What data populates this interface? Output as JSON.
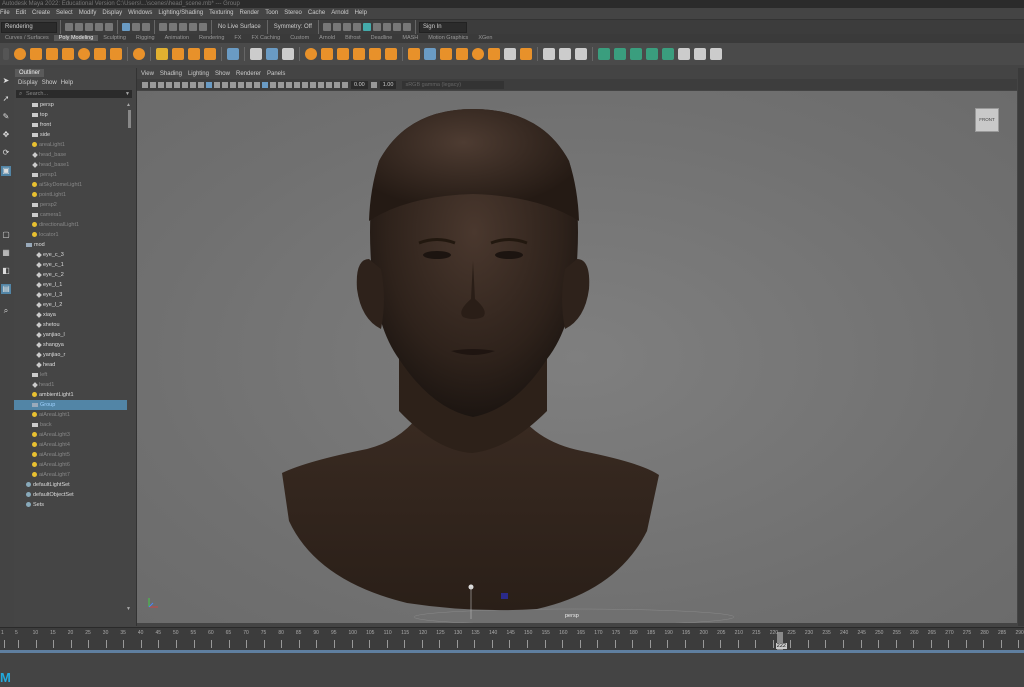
{
  "title_bar": "Autodesk Maya 2022: Educational Version C:\\Users\\...\\scenes\\head_scene.mb* --- Group",
  "menubar": [
    "File",
    "Edit",
    "Create",
    "Select",
    "Modify",
    "Display",
    "Windows",
    "Lighting/Shading",
    "Texturing",
    "Render",
    "Toon",
    "Stereo",
    "Cache",
    "Arnold",
    "Help"
  ],
  "status_line": {
    "menuset": "Rendering",
    "live_surface": "No Live Surface",
    "symmetry": "Symmetry: Off",
    "sign_in": "Sign In"
  },
  "shelf_tabs": [
    "Curves / Surfaces",
    "Poly Modeling",
    "Sculpting",
    "Rigging",
    "Animation",
    "Rendering",
    "FX",
    "FX Caching",
    "Custom",
    "Arnold",
    "Bifrost",
    "Deadline",
    "MASH",
    "Motion Graphics",
    "XGen"
  ],
  "shelf_active_tab": "Poly Modeling",
  "outliner": {
    "title": "Outliner",
    "menu": [
      "Display",
      "Show",
      "Help"
    ],
    "search_placeholder": "Search...",
    "items": [
      {
        "label": "persp",
        "type": "cam",
        "indent": 1,
        "dim": false
      },
      {
        "label": "top",
        "type": "cam",
        "indent": 1,
        "dim": false
      },
      {
        "label": "front",
        "type": "cam",
        "indent": 1,
        "dim": false
      },
      {
        "label": "side",
        "type": "cam",
        "indent": 1,
        "dim": false
      },
      {
        "label": "areaLight1",
        "type": "light",
        "indent": 1,
        "dim": true
      },
      {
        "label": "head_base",
        "type": "mesh",
        "indent": 1,
        "dim": true
      },
      {
        "label": "head_base1",
        "type": "mesh",
        "indent": 1,
        "dim": true
      },
      {
        "label": "persp1",
        "type": "cam",
        "indent": 1,
        "dim": true
      },
      {
        "label": "aiSkyDomeLight1",
        "type": "light",
        "indent": 1,
        "dim": true
      },
      {
        "label": "pointLight1",
        "type": "light",
        "indent": 1,
        "dim": true
      },
      {
        "label": "persp2",
        "type": "cam",
        "indent": 1,
        "dim": true
      },
      {
        "label": "camera1",
        "type": "cam",
        "indent": 1,
        "dim": true
      },
      {
        "label": "directionalLight1",
        "type": "light",
        "indent": 1,
        "dim": true
      },
      {
        "label": "locator1",
        "type": "light",
        "indent": 1,
        "dim": true
      },
      {
        "label": "mod",
        "type": "grp",
        "indent": 0,
        "dim": false
      },
      {
        "label": "eye_c_3",
        "type": "mesh",
        "indent": 2,
        "dim": false
      },
      {
        "label": "eye_c_1",
        "type": "mesh",
        "indent": 2,
        "dim": false
      },
      {
        "label": "eye_c_2",
        "type": "mesh",
        "indent": 2,
        "dim": false
      },
      {
        "label": "eye_l_1",
        "type": "mesh",
        "indent": 2,
        "dim": false
      },
      {
        "label": "eye_l_3",
        "type": "mesh",
        "indent": 2,
        "dim": false
      },
      {
        "label": "eye_l_2",
        "type": "mesh",
        "indent": 2,
        "dim": false
      },
      {
        "label": "xiaya",
        "type": "mesh",
        "indent": 2,
        "dim": false
      },
      {
        "label": "shetou",
        "type": "mesh",
        "indent": 2,
        "dim": false
      },
      {
        "label": "yanjiao_l",
        "type": "mesh",
        "indent": 2,
        "dim": false
      },
      {
        "label": "shangya",
        "type": "mesh",
        "indent": 2,
        "dim": false
      },
      {
        "label": "yanjiao_r",
        "type": "mesh",
        "indent": 2,
        "dim": false
      },
      {
        "label": "head",
        "type": "mesh",
        "indent": 2,
        "dim": false
      },
      {
        "label": "left",
        "type": "cam",
        "indent": 1,
        "dim": true
      },
      {
        "label": "head1",
        "type": "mesh",
        "indent": 1,
        "dim": true
      },
      {
        "label": "ambientLight1",
        "type": "light",
        "indent": 1,
        "dim": false
      },
      {
        "label": "Group",
        "type": "grp",
        "indent": 1,
        "dim": false,
        "selected": true
      },
      {
        "label": "aiAreaLight1",
        "type": "light",
        "indent": 1,
        "dim": true
      },
      {
        "label": "back",
        "type": "cam",
        "indent": 1,
        "dim": true
      },
      {
        "label": "aiAreaLight3",
        "type": "light",
        "indent": 1,
        "dim": true
      },
      {
        "label": "aiAreaLight4",
        "type": "light",
        "indent": 1,
        "dim": true
      },
      {
        "label": "aiAreaLight5",
        "type": "light",
        "indent": 1,
        "dim": true
      },
      {
        "label": "aiAreaLight6",
        "type": "light",
        "indent": 1,
        "dim": true
      },
      {
        "label": "aiAreaLight7",
        "type": "light",
        "indent": 1,
        "dim": true
      },
      {
        "label": "defaultLightSet",
        "type": "set",
        "indent": 0,
        "dim": false
      },
      {
        "label": "defaultObjectSet",
        "type": "set",
        "indent": 0,
        "dim": false
      },
      {
        "label": "Sets",
        "type": "set",
        "indent": 0,
        "dim": false
      }
    ]
  },
  "viewport": {
    "menu": [
      "View",
      "Shading",
      "Lighting",
      "Show",
      "Renderer",
      "Panels"
    ],
    "exposure": "0.00",
    "gamma": "1.00",
    "color_space": "sRGB gamma (legacy)",
    "view_cube_label": "FRONT",
    "camera_label": "persp"
  },
  "timeline": {
    "start": 1,
    "end": 290,
    "step": 5,
    "current_frame": "222"
  }
}
